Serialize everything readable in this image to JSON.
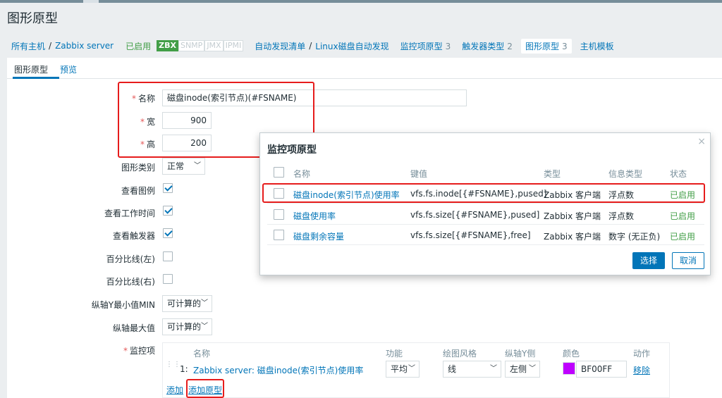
{
  "page": {
    "title": "图形原型"
  },
  "breadcrumb": {
    "all_hosts": "所有主机",
    "sep": "/",
    "host": "Zabbix server",
    "status": "已启用",
    "tags": [
      "ZBX",
      "SNMP",
      "JMX",
      "IPMI"
    ],
    "discovery_list": "自动发现清单",
    "discovery_rule": "Linux磁盘自动发现",
    "item_prototypes": "监控项原型",
    "item_prototypes_count": "3",
    "trigger_types": "触发器类型",
    "trigger_types_count": "2",
    "graph_prototypes": "图形原型",
    "graph_prototypes_count": "3",
    "host_templates": "主机模板"
  },
  "tabs": [
    "图形原型",
    "预览"
  ],
  "form": {
    "name_label": "名称",
    "name_value": "磁盘inode(索引节点)(#FSNAME)",
    "width_label": "宽",
    "width_value": "900",
    "height_label": "高",
    "height_value": "200",
    "graph_type_label": "图形类别",
    "graph_type_value": "正常",
    "show_legend_label": "查看图例",
    "show_working_time_label": "查看工作时间",
    "show_triggers_label": "查看触发器",
    "percentile_left_label": "百分比线(左)",
    "percentile_right_label": "百分比线(右)",
    "ymin_label": "纵轴Y最小值MIN",
    "ymin_value": "可计算的",
    "ymax_label": "纵轴最大值",
    "ymax_value": "可计算的",
    "items_label": "监控项"
  },
  "items_table": {
    "headers": [
      "名称",
      "功能",
      "绘图风格",
      "纵轴Y侧",
      "颜色",
      "动作"
    ],
    "row": {
      "index": "1:",
      "name": "Zabbix server: 磁盘inode(索引节点)使用率",
      "function": "平均",
      "draw_style": "线",
      "y_side": "左侧",
      "color": "BF00FF",
      "color_hex": "#bf00ff",
      "action": "移除"
    },
    "add_label": "添加",
    "add_prototype_label": "添加原型"
  },
  "modal": {
    "title": "监控项原型",
    "close": "×",
    "headers": [
      "名称",
      "键值",
      "类型",
      "信息类型",
      "状态"
    ],
    "rows": [
      {
        "name": "磁盘inode(索引节点)使用率",
        "key": "vfs.fs.inode[{#FSNAME},pused]",
        "type": "Zabbix 客户端",
        "info": "浮点数",
        "status": "已启用"
      },
      {
        "name": "磁盘使用率",
        "key": "vfs.fs.size[{#FSNAME},pused]",
        "type": "Zabbix 客户端",
        "info": "浮点数",
        "status": "已启用"
      },
      {
        "name": "磁盘剩余容量",
        "key": "vfs.fs.size[{#FSNAME},free]",
        "type": "Zabbix 客户端",
        "info": "数字 (无正负)",
        "status": "已启用"
      }
    ],
    "select_button": "选择",
    "cancel_button": "取消"
  },
  "icons": {
    "chevron": "chevron-down-icon",
    "drag": "drag-handle-icon",
    "close": "close-icon"
  },
  "colors": {
    "accent": "#0275b8",
    "status_green": "#429e47",
    "highlight_red": "#e61c1c",
    "required": "#e45959"
  }
}
